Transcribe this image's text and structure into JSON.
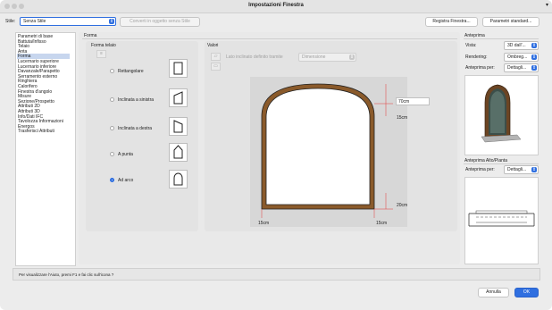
{
  "window": {
    "title": "Impostazioni Finestra"
  },
  "style": {
    "label": "Stile:",
    "value": "Senza Stile",
    "convert_label": "Converti in oggetto senza Stile"
  },
  "header_buttons": {
    "save": "Registra Finestra...",
    "standard": "Parametri standard..."
  },
  "nav": {
    "items": [
      "Parametri di base",
      "Battuta/Infisso",
      "Telaio",
      "Anta",
      "Forma",
      "Lucernario superiore",
      "Lucernario inferiore",
      "Davanzale/Parapetto",
      "Serramento esterno",
      "Ringhiera",
      "Calorifero",
      "Finestra d'angolo",
      "Misure",
      "Sezione/Prospetto",
      "Attributi 2D",
      "Attributi 3D",
      "Info/Dati IFC",
      "Tavolozza Informazioni",
      "Energos",
      "Trasferisci Attributi"
    ],
    "selected_index": 4
  },
  "forma": {
    "section_title": "Forma",
    "telaio_label": "Forma telaio",
    "options": [
      {
        "label": "Rettangolare",
        "icon": "rect-window-icon"
      },
      {
        "label": "Inclinata a sinistra",
        "icon": "slant-left-window-icon"
      },
      {
        "label": "Inclinata a destra",
        "icon": "slant-right-window-icon"
      },
      {
        "label": "A punta",
        "icon": "pointed-window-icon"
      },
      {
        "label": "Ad arco",
        "icon": "arched-window-icon"
      }
    ],
    "selected_index": 4
  },
  "valori": {
    "label": "Valori",
    "side_label": "Lato inclinato definito tramite",
    "side_value": "Dimensione",
    "dims": {
      "top_input": "70cm",
      "right_upper": "15cm",
      "right_lower": "20cm",
      "bottom_left": "15cm",
      "bottom_right": "15cm"
    }
  },
  "anteprima": {
    "title": "Anteprima",
    "vista_label": "Vista:",
    "vista_value": "3D dall'...",
    "rendering_label": "Rendering:",
    "rendering_value": "Ombreg...",
    "per_label": "Anteprima per:",
    "per_value": "Dettagli..."
  },
  "anteprima_alto": {
    "title": "Anteprima Alto/Pianta",
    "per_label": "Anteprima per:",
    "per_value": "Dettagli..."
  },
  "help_text": "Per visualizzare l'Aiuto, premi F1 e fai clic sull'icona ?",
  "footer": {
    "cancel": "Annulla",
    "ok": "OK"
  },
  "colors": {
    "accent": "#2f6fe0",
    "frame": "#8a5a2b"
  }
}
